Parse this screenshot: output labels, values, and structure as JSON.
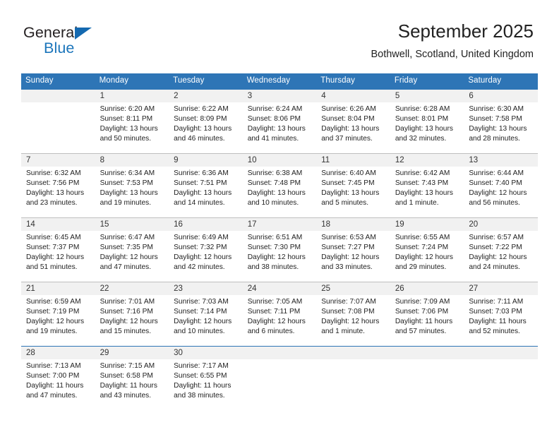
{
  "brand": {
    "name_part1": "General",
    "name_part2": "Blue",
    "triangle_color": "#1469b0",
    "blue_color": "#1b75bb"
  },
  "header": {
    "title": "September 2025",
    "subtitle": "Bothwell, Scotland, United Kingdom"
  },
  "theme": {
    "header_bg": "#2e75b6",
    "daynum_bg": "#f1f1f1",
    "grid_line": "#bfbfbf"
  },
  "labels": {
    "sunrise_prefix": "Sunrise:",
    "sunset_prefix": "Sunset:",
    "daylight_prefix": "Daylight:"
  },
  "weekdays": [
    "Sunday",
    "Monday",
    "Tuesday",
    "Wednesday",
    "Thursday",
    "Friday",
    "Saturday"
  ],
  "weeks": [
    [
      {
        "day": "",
        "line1": "",
        "line2": "",
        "line3": "",
        "line4": ""
      },
      {
        "day": "1",
        "line1": "Sunrise: 6:20 AM",
        "line2": "Sunset: 8:11 PM",
        "line3": "Daylight: 13 hours",
        "line4": "and 50 minutes."
      },
      {
        "day": "2",
        "line1": "Sunrise: 6:22 AM",
        "line2": "Sunset: 8:09 PM",
        "line3": "Daylight: 13 hours",
        "line4": "and 46 minutes."
      },
      {
        "day": "3",
        "line1": "Sunrise: 6:24 AM",
        "line2": "Sunset: 8:06 PM",
        "line3": "Daylight: 13 hours",
        "line4": "and 41 minutes."
      },
      {
        "day": "4",
        "line1": "Sunrise: 6:26 AM",
        "line2": "Sunset: 8:04 PM",
        "line3": "Daylight: 13 hours",
        "line4": "and 37 minutes."
      },
      {
        "day": "5",
        "line1": "Sunrise: 6:28 AM",
        "line2": "Sunset: 8:01 PM",
        "line3": "Daylight: 13 hours",
        "line4": "and 32 minutes."
      },
      {
        "day": "6",
        "line1": "Sunrise: 6:30 AM",
        "line2": "Sunset: 7:58 PM",
        "line3": "Daylight: 13 hours",
        "line4": "and 28 minutes."
      }
    ],
    [
      {
        "day": "7",
        "line1": "Sunrise: 6:32 AM",
        "line2": "Sunset: 7:56 PM",
        "line3": "Daylight: 13 hours",
        "line4": "and 23 minutes."
      },
      {
        "day": "8",
        "line1": "Sunrise: 6:34 AM",
        "line2": "Sunset: 7:53 PM",
        "line3": "Daylight: 13 hours",
        "line4": "and 19 minutes."
      },
      {
        "day": "9",
        "line1": "Sunrise: 6:36 AM",
        "line2": "Sunset: 7:51 PM",
        "line3": "Daylight: 13 hours",
        "line4": "and 14 minutes."
      },
      {
        "day": "10",
        "line1": "Sunrise: 6:38 AM",
        "line2": "Sunset: 7:48 PM",
        "line3": "Daylight: 13 hours",
        "line4": "and 10 minutes."
      },
      {
        "day": "11",
        "line1": "Sunrise: 6:40 AM",
        "line2": "Sunset: 7:45 PM",
        "line3": "Daylight: 13 hours",
        "line4": "and 5 minutes."
      },
      {
        "day": "12",
        "line1": "Sunrise: 6:42 AM",
        "line2": "Sunset: 7:43 PM",
        "line3": "Daylight: 13 hours",
        "line4": "and 1 minute."
      },
      {
        "day": "13",
        "line1": "Sunrise: 6:44 AM",
        "line2": "Sunset: 7:40 PM",
        "line3": "Daylight: 12 hours",
        "line4": "and 56 minutes."
      }
    ],
    [
      {
        "day": "14",
        "line1": "Sunrise: 6:45 AM",
        "line2": "Sunset: 7:37 PM",
        "line3": "Daylight: 12 hours",
        "line4": "and 51 minutes."
      },
      {
        "day": "15",
        "line1": "Sunrise: 6:47 AM",
        "line2": "Sunset: 7:35 PM",
        "line3": "Daylight: 12 hours",
        "line4": "and 47 minutes."
      },
      {
        "day": "16",
        "line1": "Sunrise: 6:49 AM",
        "line2": "Sunset: 7:32 PM",
        "line3": "Daylight: 12 hours",
        "line4": "and 42 minutes."
      },
      {
        "day": "17",
        "line1": "Sunrise: 6:51 AM",
        "line2": "Sunset: 7:30 PM",
        "line3": "Daylight: 12 hours",
        "line4": "and 38 minutes."
      },
      {
        "day": "18",
        "line1": "Sunrise: 6:53 AM",
        "line2": "Sunset: 7:27 PM",
        "line3": "Daylight: 12 hours",
        "line4": "and 33 minutes."
      },
      {
        "day": "19",
        "line1": "Sunrise: 6:55 AM",
        "line2": "Sunset: 7:24 PM",
        "line3": "Daylight: 12 hours",
        "line4": "and 29 minutes."
      },
      {
        "day": "20",
        "line1": "Sunrise: 6:57 AM",
        "line2": "Sunset: 7:22 PM",
        "line3": "Daylight: 12 hours",
        "line4": "and 24 minutes."
      }
    ],
    [
      {
        "day": "21",
        "line1": "Sunrise: 6:59 AM",
        "line2": "Sunset: 7:19 PM",
        "line3": "Daylight: 12 hours",
        "line4": "and 19 minutes."
      },
      {
        "day": "22",
        "line1": "Sunrise: 7:01 AM",
        "line2": "Sunset: 7:16 PM",
        "line3": "Daylight: 12 hours",
        "line4": "and 15 minutes."
      },
      {
        "day": "23",
        "line1": "Sunrise: 7:03 AM",
        "line2": "Sunset: 7:14 PM",
        "line3": "Daylight: 12 hours",
        "line4": "and 10 minutes."
      },
      {
        "day": "24",
        "line1": "Sunrise: 7:05 AM",
        "line2": "Sunset: 7:11 PM",
        "line3": "Daylight: 12 hours",
        "line4": "and 6 minutes."
      },
      {
        "day": "25",
        "line1": "Sunrise: 7:07 AM",
        "line2": "Sunset: 7:08 PM",
        "line3": "Daylight: 12 hours",
        "line4": "and 1 minute."
      },
      {
        "day": "26",
        "line1": "Sunrise: 7:09 AM",
        "line2": "Sunset: 7:06 PM",
        "line3": "Daylight: 11 hours",
        "line4": "and 57 minutes."
      },
      {
        "day": "27",
        "line1": "Sunrise: 7:11 AM",
        "line2": "Sunset: 7:03 PM",
        "line3": "Daylight: 11 hours",
        "line4": "and 52 minutes."
      }
    ],
    [
      {
        "day": "28",
        "line1": "Sunrise: 7:13 AM",
        "line2": "Sunset: 7:00 PM",
        "line3": "Daylight: 11 hours",
        "line4": "and 47 minutes."
      },
      {
        "day": "29",
        "line1": "Sunrise: 7:15 AM",
        "line2": "Sunset: 6:58 PM",
        "line3": "Daylight: 11 hours",
        "line4": "and 43 minutes."
      },
      {
        "day": "30",
        "line1": "Sunrise: 7:17 AM",
        "line2": "Sunset: 6:55 PM",
        "line3": "Daylight: 11 hours",
        "line4": "and 38 minutes."
      },
      {
        "day": "",
        "line1": "",
        "line2": "",
        "line3": "",
        "line4": ""
      },
      {
        "day": "",
        "line1": "",
        "line2": "",
        "line3": "",
        "line4": ""
      },
      {
        "day": "",
        "line1": "",
        "line2": "",
        "line3": "",
        "line4": ""
      },
      {
        "day": "",
        "line1": "",
        "line2": "",
        "line3": "",
        "line4": ""
      }
    ]
  ]
}
